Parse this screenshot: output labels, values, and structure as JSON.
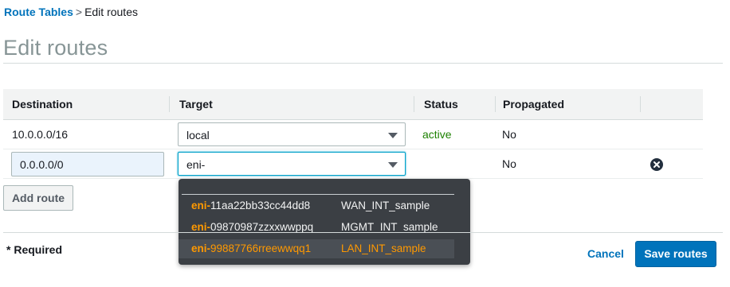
{
  "breadcrumb": {
    "parent": "Route Tables",
    "separator": ">",
    "current": "Edit routes"
  },
  "page_title": "Edit routes",
  "table": {
    "columns": [
      "Destination",
      "Target",
      "Status",
      "Propagated"
    ],
    "rows": [
      {
        "destination": "10.0.0.0/16",
        "target": "local",
        "status": "active",
        "propagated": "No"
      },
      {
        "destination": "0.0.0.0/0",
        "target": "eni-",
        "status": "",
        "propagated": "No"
      }
    ]
  },
  "dropdown": {
    "items": [
      {
        "prefix": "eni-",
        "id_rest": "11aa22bb33cc44dd8",
        "name": "WAN_INT_sample"
      },
      {
        "prefix": "eni-",
        "id_rest": "09870987zzxxwwppq",
        "name": "MGMT_INT_sample"
      },
      {
        "prefix": "eni-",
        "id_rest": "99887766rreewwqq1",
        "name": "LAN_INT_sample"
      }
    ]
  },
  "buttons": {
    "add_route": "Add route",
    "cancel": "Cancel",
    "save_routes": "Save routes"
  },
  "required_note": "* Required",
  "colors": {
    "link": "#0073bb",
    "active": "#1d8102",
    "primary": "#0073bb",
    "highlight": "#ff9900",
    "dropdown_bg": "#3b3f44"
  },
  "icons": {
    "remove": "remove-circle-icon",
    "caret": "caret-down-icon"
  }
}
